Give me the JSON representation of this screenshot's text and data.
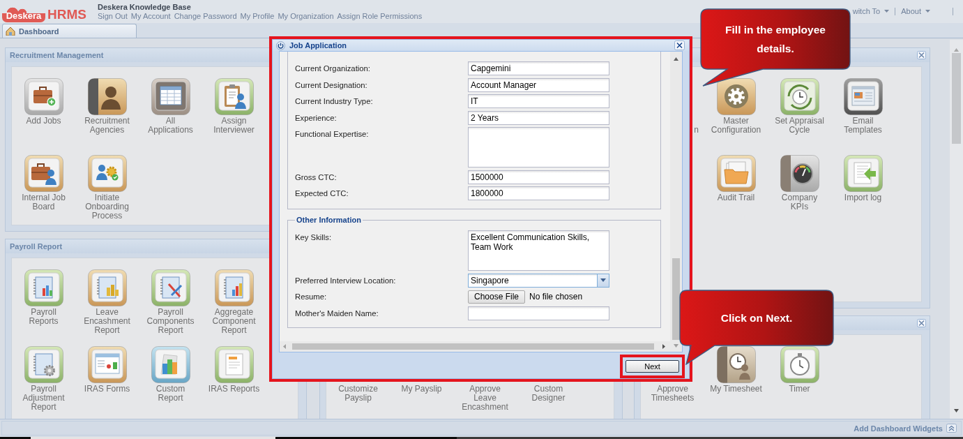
{
  "header": {
    "logo": {
      "cloud_text": "Deskera",
      "text": "HRMS"
    },
    "title": "Deskera Knowledge Base",
    "links": [
      "Sign Out",
      "My Account",
      "Change Password",
      "My Profile",
      "My Organization",
      "Assign Role Permissions"
    ],
    "menus": [
      "witch To",
      "About"
    ]
  },
  "tabs": [
    {
      "label": "Dashboard",
      "selected": true
    }
  ],
  "columns": [
    {
      "portlets": [
        {
          "title": "Recruitment Management",
          "items": [
            "Add Jobs",
            "Recruitment\nAgencies",
            "All\nApplications",
            "Assign\nInterviewer",
            "Internal Job\nBoard",
            "Initiate\nOnboarding\nProcess"
          ]
        },
        {
          "title": "Payroll Report",
          "items": [
            "Payroll\nReports",
            "Leave\nEncashment\nReport",
            "Payroll\nComponents\nReport",
            "Aggregate\nComponent\nReport",
            "Payroll\nAdjustment\nReport",
            "IRAS Forms",
            "Custom\nReport",
            "IRAS Reports"
          ]
        }
      ]
    },
    {
      "portlets": [
        {
          "items": [
            "Customize\nPayslip",
            "My Payslip",
            "Approve\nLeave\nEncashment",
            "Custom\nDesigner"
          ]
        }
      ]
    },
    {
      "portlets": [
        {
          "closable": true,
          "cut_label": "n",
          "items": [
            "Master\nConfiguration",
            "Set Appraisal\nCycle",
            "Email\nTemplates",
            "Audit Trail",
            "Company\nKPIs",
            "Import log"
          ]
        },
        {
          "closable": true,
          "items": [
            "Approve\nTimesheets",
            "My Timesheet",
            "Timer"
          ]
        }
      ]
    }
  ],
  "dialog": {
    "title": "Job Application",
    "sections": [
      {
        "fields": [
          {
            "label": "Current Organization:",
            "kind": "text",
            "value": "Capgemini",
            "focused": false
          },
          {
            "label": "Current Designation:",
            "kind": "text",
            "value": "Account Manager",
            "focused": false
          },
          {
            "label": "Current Industry Type:",
            "kind": "text",
            "value": "IT",
            "focused": false
          },
          {
            "label": "Experience:",
            "kind": "text",
            "value": "2 Years",
            "focused": false
          },
          {
            "label": "Functional Expertise:",
            "kind": "textarea",
            "focused": false
          },
          {
            "label": "Gross CTC:",
            "kind": "text",
            "value": "1500000",
            "focused": false
          },
          {
            "label": "Expected CTC:",
            "kind": "text",
            "value": "1800000",
            "focused": false
          }
        ]
      },
      {
        "legend": "Other Information",
        "fields": [
          {
            "label": "Key Skills:",
            "kind": "textarea",
            "value": "Excellent Communication Skills, Team Work",
            "focused": false
          },
          {
            "label": "Preferred Interview Location:",
            "kind": "combo",
            "value": "Singapore",
            "focused": true
          },
          {
            "label": "Resume:",
            "kind": "file",
            "button": "Choose File",
            "status": "No file chosen",
            "focused": false
          },
          {
            "label": "Mother's Maiden Name:",
            "kind": "text",
            "focused": false
          }
        ]
      }
    ],
    "buttons": [
      "Next"
    ]
  },
  "footer": {
    "link": "Add Dashboard Widgets"
  },
  "callouts": [
    {
      "text": "Fill in the employee details."
    },
    {
      "text": "Click on Next."
    }
  ]
}
